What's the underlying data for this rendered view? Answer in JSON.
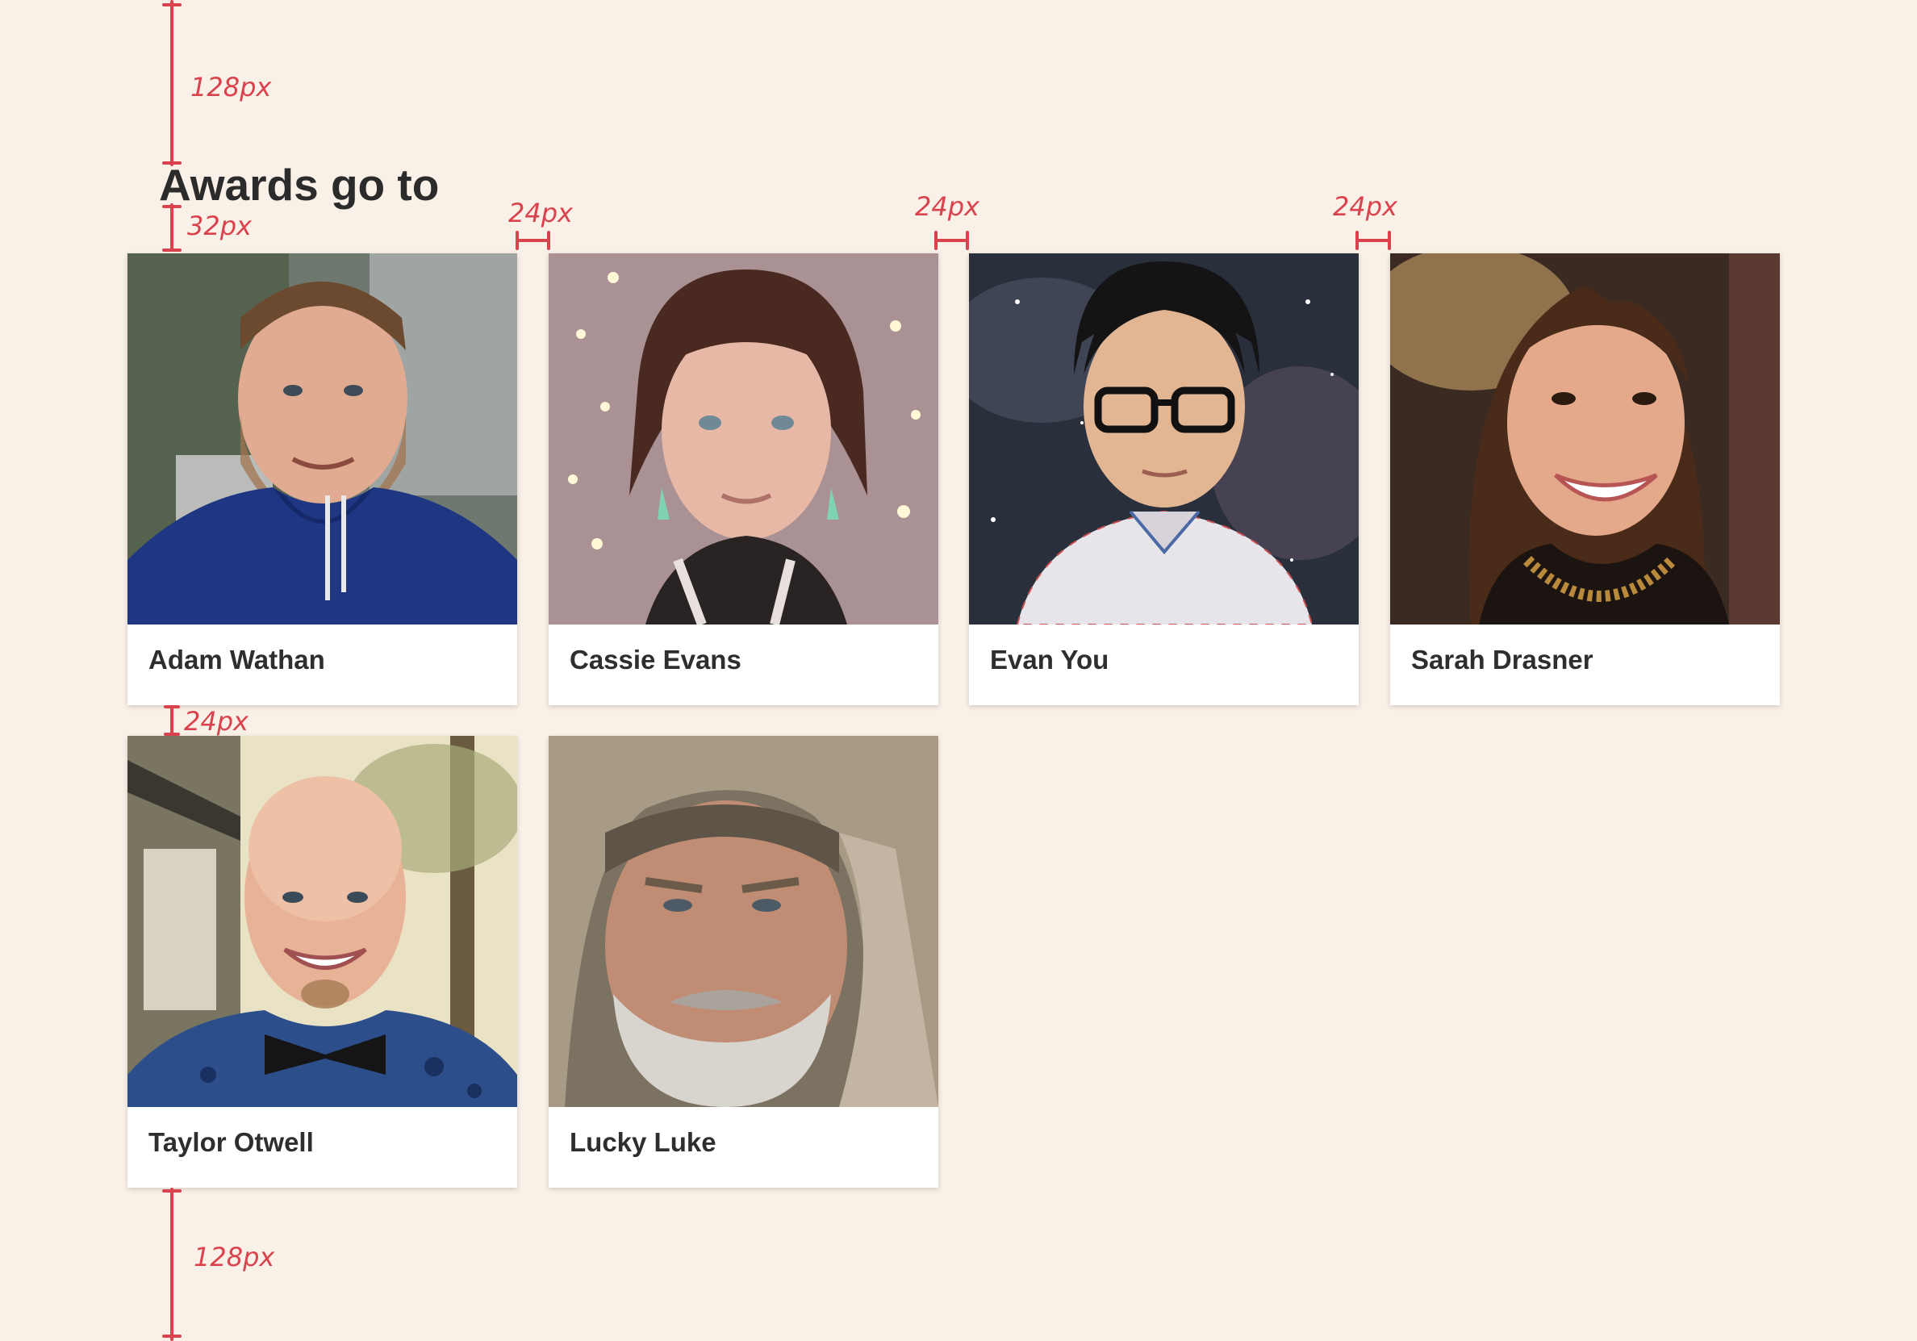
{
  "heading": "Awards go to",
  "colors": {
    "background": "#f9f0e7",
    "card": "#ffffff",
    "text": "#2b2b2b",
    "annotation": "#d9434d"
  },
  "annotations": {
    "top_spacing": "128px",
    "title_gap": "32px",
    "col_gap_1": "24px",
    "col_gap_2": "24px",
    "col_gap_3": "24px",
    "row_gap": "24px",
    "bottom_spacing": "128px"
  },
  "awardees": [
    {
      "name": "Adam Wathan",
      "photo": "portrait-photo"
    },
    {
      "name": "Cassie Evans",
      "photo": "portrait-photo"
    },
    {
      "name": "Evan You",
      "photo": "portrait-photo"
    },
    {
      "name": "Sarah Drasner",
      "photo": "portrait-photo"
    },
    {
      "name": "Taylor Otwell",
      "photo": "portrait-photo"
    },
    {
      "name": "Lucky Luke",
      "photo": "portrait-photo"
    }
  ]
}
